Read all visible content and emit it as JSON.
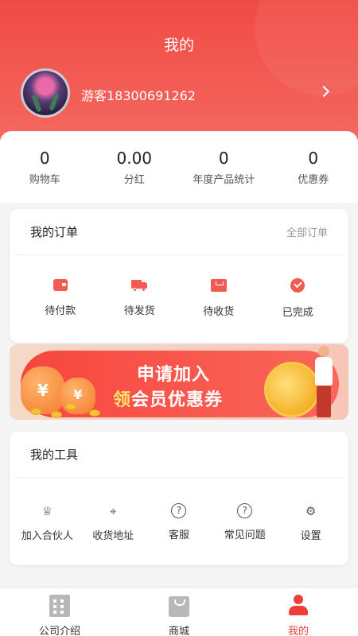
{
  "header": {
    "title": "我的",
    "username": "游客18300691262"
  },
  "stats": [
    {
      "value": "0",
      "label": "购物车"
    },
    {
      "value": "0.00",
      "label": "分红"
    },
    {
      "value": "0",
      "label": "年度产品统计"
    },
    {
      "value": "0",
      "label": "优惠券"
    }
  ],
  "orders": {
    "title": "我的订单",
    "all_link": "全部订单",
    "items": [
      {
        "label": "待付款",
        "icon": "wallet-icon"
      },
      {
        "label": "待发货",
        "icon": "truck-icon"
      },
      {
        "label": "待收货",
        "icon": "package-icon"
      },
      {
        "label": "已完成",
        "icon": "check-circle-icon"
      }
    ]
  },
  "banner": {
    "line1": "申请加入",
    "line2_highlight": "领",
    "line2_rest": "会员优惠券"
  },
  "tools": {
    "title": "我的工具",
    "items": [
      {
        "label": "加入合伙人",
        "icon": "crown-icon"
      },
      {
        "label": "收货地址",
        "icon": "location-icon"
      },
      {
        "label": "客服",
        "icon": "help-icon"
      },
      {
        "label": "常见问题",
        "icon": "question-icon"
      },
      {
        "label": "设置",
        "icon": "gear-icon"
      }
    ]
  },
  "bottom_nav": [
    {
      "label": "公司介绍",
      "icon": "building-icon"
    },
    {
      "label": "商城",
      "icon": "shopping-bag-icon"
    },
    {
      "label": "我的",
      "icon": "user-icon",
      "active": true
    }
  ],
  "colors": {
    "accent": "#f03f3a",
    "header_top": "#f14a45"
  }
}
